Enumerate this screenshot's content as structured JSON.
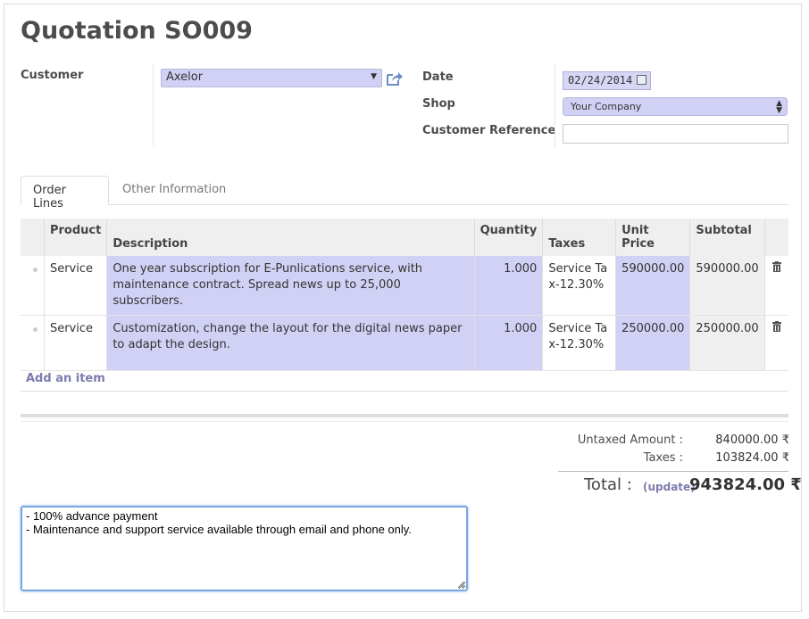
{
  "form": {
    "title": "Quotation SO009"
  },
  "fields": {
    "customer_label": "Customer",
    "customer_value": "Axelor",
    "date_label": "Date",
    "date_value": "02/24/2014",
    "shop_label": "Shop",
    "shop_value": "Your Company",
    "customer_ref_label": "Customer Reference",
    "customer_ref_value": ""
  },
  "tabs": [
    {
      "label": "Order Lines",
      "active": true
    },
    {
      "label": "Other Information",
      "active": false
    }
  ],
  "order_lines": {
    "headers": {
      "product": "Product",
      "description": "Description",
      "quantity": "Quantity",
      "taxes": "Taxes",
      "unit_price": "Unit Price",
      "subtotal": "Subtotal"
    },
    "rows": [
      {
        "product": "Service",
        "description": "One year subscription for E-Punlications service, with maintenance contract. Spread news up to 25,000 subscribers.",
        "quantity": "1.000",
        "taxes": "Service Tax-12.30%",
        "unit_price": "590000.00",
        "subtotal": "590000.00"
      },
      {
        "product": "Service",
        "description": "Customization, change the layout for the digital news paper to adapt the design.",
        "quantity": "1.000",
        "taxes": "Service Tax-12.30%",
        "unit_price": "250000.00",
        "subtotal": "250000.00"
      }
    ],
    "add_item_label": "Add an item"
  },
  "totals": {
    "untaxed_label": "Untaxed Amount :",
    "untaxed_value": "840000.00 ₹",
    "taxes_label": "Taxes :",
    "taxes_value": "103824.00 ₹",
    "total_label": "Total :",
    "update_label": "(update)",
    "total_value": "943824.00 ₹"
  },
  "notes": {
    "text": "- 100% advance payment\n- Maintenance and support service available through email and phone only."
  },
  "colors": {
    "highlight": "#d1d1f5",
    "link": "#7c7bad",
    "focus_border": "#7aa6e0"
  },
  "icons": [
    "external-link-icon",
    "calendar-icon",
    "trash-icon",
    "resize-grip-icon"
  ]
}
